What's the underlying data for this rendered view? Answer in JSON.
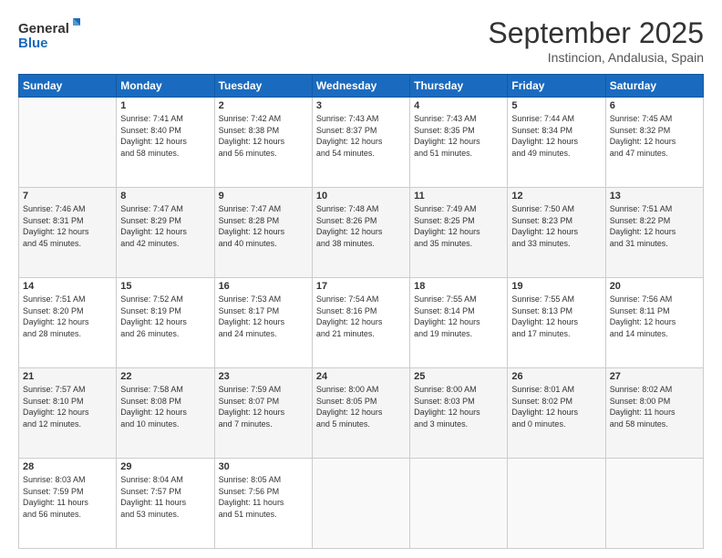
{
  "logo": {
    "line1": "General",
    "line2": "Blue"
  },
  "header": {
    "month": "September 2025",
    "location": "Instincion, Andalusia, Spain"
  },
  "days_of_week": [
    "Sunday",
    "Monday",
    "Tuesday",
    "Wednesday",
    "Thursday",
    "Friday",
    "Saturday"
  ],
  "weeks": [
    [
      {
        "num": "",
        "info": ""
      },
      {
        "num": "1",
        "info": "Sunrise: 7:41 AM\nSunset: 8:40 PM\nDaylight: 12 hours\nand 58 minutes."
      },
      {
        "num": "2",
        "info": "Sunrise: 7:42 AM\nSunset: 8:38 PM\nDaylight: 12 hours\nand 56 minutes."
      },
      {
        "num": "3",
        "info": "Sunrise: 7:43 AM\nSunset: 8:37 PM\nDaylight: 12 hours\nand 54 minutes."
      },
      {
        "num": "4",
        "info": "Sunrise: 7:43 AM\nSunset: 8:35 PM\nDaylight: 12 hours\nand 51 minutes."
      },
      {
        "num": "5",
        "info": "Sunrise: 7:44 AM\nSunset: 8:34 PM\nDaylight: 12 hours\nand 49 minutes."
      },
      {
        "num": "6",
        "info": "Sunrise: 7:45 AM\nSunset: 8:32 PM\nDaylight: 12 hours\nand 47 minutes."
      }
    ],
    [
      {
        "num": "7",
        "info": "Sunrise: 7:46 AM\nSunset: 8:31 PM\nDaylight: 12 hours\nand 45 minutes."
      },
      {
        "num": "8",
        "info": "Sunrise: 7:47 AM\nSunset: 8:29 PM\nDaylight: 12 hours\nand 42 minutes."
      },
      {
        "num": "9",
        "info": "Sunrise: 7:47 AM\nSunset: 8:28 PM\nDaylight: 12 hours\nand 40 minutes."
      },
      {
        "num": "10",
        "info": "Sunrise: 7:48 AM\nSunset: 8:26 PM\nDaylight: 12 hours\nand 38 minutes."
      },
      {
        "num": "11",
        "info": "Sunrise: 7:49 AM\nSunset: 8:25 PM\nDaylight: 12 hours\nand 35 minutes."
      },
      {
        "num": "12",
        "info": "Sunrise: 7:50 AM\nSunset: 8:23 PM\nDaylight: 12 hours\nand 33 minutes."
      },
      {
        "num": "13",
        "info": "Sunrise: 7:51 AM\nSunset: 8:22 PM\nDaylight: 12 hours\nand 31 minutes."
      }
    ],
    [
      {
        "num": "14",
        "info": "Sunrise: 7:51 AM\nSunset: 8:20 PM\nDaylight: 12 hours\nand 28 minutes."
      },
      {
        "num": "15",
        "info": "Sunrise: 7:52 AM\nSunset: 8:19 PM\nDaylight: 12 hours\nand 26 minutes."
      },
      {
        "num": "16",
        "info": "Sunrise: 7:53 AM\nSunset: 8:17 PM\nDaylight: 12 hours\nand 24 minutes."
      },
      {
        "num": "17",
        "info": "Sunrise: 7:54 AM\nSunset: 8:16 PM\nDaylight: 12 hours\nand 21 minutes."
      },
      {
        "num": "18",
        "info": "Sunrise: 7:55 AM\nSunset: 8:14 PM\nDaylight: 12 hours\nand 19 minutes."
      },
      {
        "num": "19",
        "info": "Sunrise: 7:55 AM\nSunset: 8:13 PM\nDaylight: 12 hours\nand 17 minutes."
      },
      {
        "num": "20",
        "info": "Sunrise: 7:56 AM\nSunset: 8:11 PM\nDaylight: 12 hours\nand 14 minutes."
      }
    ],
    [
      {
        "num": "21",
        "info": "Sunrise: 7:57 AM\nSunset: 8:10 PM\nDaylight: 12 hours\nand 12 minutes."
      },
      {
        "num": "22",
        "info": "Sunrise: 7:58 AM\nSunset: 8:08 PM\nDaylight: 12 hours\nand 10 minutes."
      },
      {
        "num": "23",
        "info": "Sunrise: 7:59 AM\nSunset: 8:07 PM\nDaylight: 12 hours\nand 7 minutes."
      },
      {
        "num": "24",
        "info": "Sunrise: 8:00 AM\nSunset: 8:05 PM\nDaylight: 12 hours\nand 5 minutes."
      },
      {
        "num": "25",
        "info": "Sunrise: 8:00 AM\nSunset: 8:03 PM\nDaylight: 12 hours\nand 3 minutes."
      },
      {
        "num": "26",
        "info": "Sunrise: 8:01 AM\nSunset: 8:02 PM\nDaylight: 12 hours\nand 0 minutes."
      },
      {
        "num": "27",
        "info": "Sunrise: 8:02 AM\nSunset: 8:00 PM\nDaylight: 11 hours\nand 58 minutes."
      }
    ],
    [
      {
        "num": "28",
        "info": "Sunrise: 8:03 AM\nSunset: 7:59 PM\nDaylight: 11 hours\nand 56 minutes."
      },
      {
        "num": "29",
        "info": "Sunrise: 8:04 AM\nSunset: 7:57 PM\nDaylight: 11 hours\nand 53 minutes."
      },
      {
        "num": "30",
        "info": "Sunrise: 8:05 AM\nSunset: 7:56 PM\nDaylight: 11 hours\nand 51 minutes."
      },
      {
        "num": "",
        "info": ""
      },
      {
        "num": "",
        "info": ""
      },
      {
        "num": "",
        "info": ""
      },
      {
        "num": "",
        "info": ""
      }
    ]
  ]
}
